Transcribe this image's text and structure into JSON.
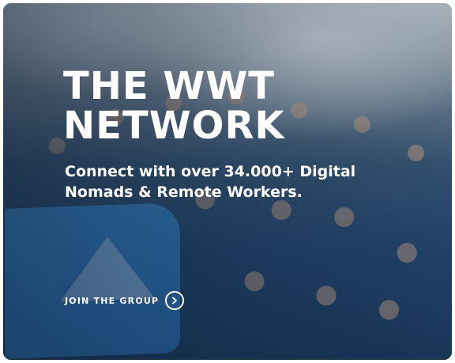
{
  "hero": {
    "title_line1": "THE WWT",
    "title_line2": "NETWORK",
    "subtitle_line1": "Connect with over 34.000+ Digital",
    "subtitle_line2": "Nomads & Remote Workers.",
    "cta_label": "JOIN THE GROUP",
    "cta_icon": "chevron-right-icon"
  },
  "colors": {
    "text": "#ffffff",
    "shirt_blue": "#23476f",
    "flag_blue": "#2f78bd"
  }
}
